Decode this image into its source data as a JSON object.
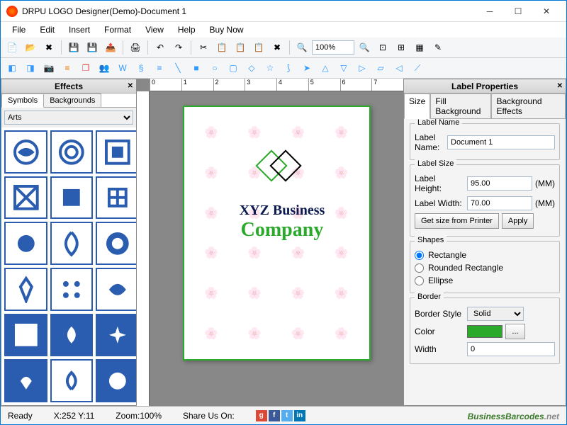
{
  "window": {
    "title": "DRPU LOGO Designer(Demo)-Document 1"
  },
  "menu": [
    "File",
    "Edit",
    "Insert",
    "Format",
    "View",
    "Help",
    "Buy Now"
  ],
  "zoom_value": "100%",
  "effects_panel": {
    "title": "Effects",
    "tabs": [
      "Symbols",
      "Backgrounds"
    ],
    "category": "Arts"
  },
  "canvas": {
    "text1": "XYZ Business",
    "text2": "Company",
    "ruler_marks": [
      "0",
      "1",
      "2",
      "3",
      "4",
      "5",
      "6",
      "7"
    ]
  },
  "props_panel": {
    "title": "Label Properties",
    "tabs": [
      "Size",
      "Fill Background",
      "Background Effects"
    ],
    "label_name_group": "Label Name",
    "label_name_lbl": "Label Name:",
    "label_name_val": "Document 1",
    "label_size_group": "Label Size",
    "height_lbl": "Label Height:",
    "height_val": "95.00",
    "width_lbl": "Label Width:",
    "width_val": "70.00",
    "unit": "(MM)",
    "get_size_btn": "Get size from Printer",
    "apply_btn": "Apply",
    "shapes_group": "Shapes",
    "shapes": [
      "Rectangle",
      "Rounded Rectangle",
      "Ellipse"
    ],
    "border_group": "Border",
    "border_style_lbl": "Border Style",
    "border_style_val": "Solid",
    "color_lbl": "Color",
    "width2_lbl": "Width",
    "width2_val": "0",
    "ellipsis": "..."
  },
  "status": {
    "ready": "Ready",
    "coords": "X:252  Y:11",
    "zoom": "Zoom:100%",
    "share": "Share Us On:",
    "brand1": "Business",
    "brand2": "Barcodes",
    "brand3": ".net"
  }
}
